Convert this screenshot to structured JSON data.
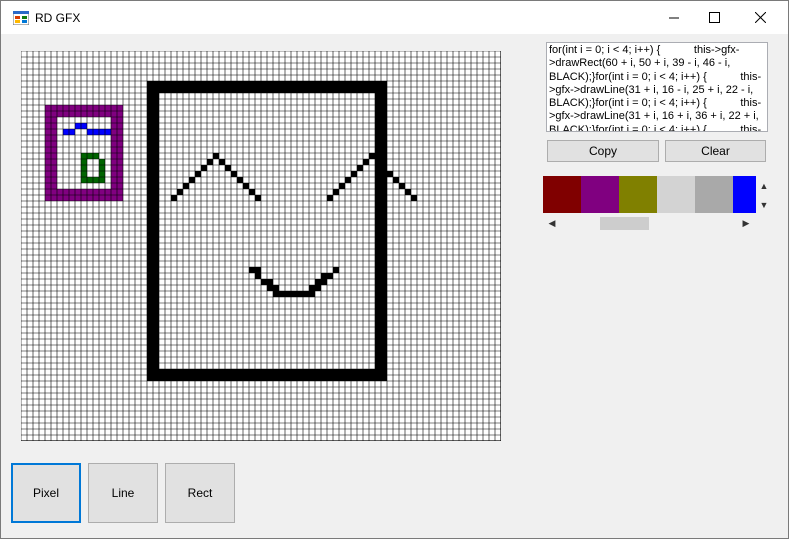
{
  "window": {
    "title": "RD GFX",
    "minimize_icon": "minimize-icon",
    "maximize_icon": "maximize-icon",
    "close_icon": "close-icon"
  },
  "code": {
    "text": "for(int i = 0; i < 4; i++) {           this->gfx->drawRect(60 + i, 50 + i, 39 - i, 46 - i, BLACK);}for(int i = 0; i < 4; i++) {           this->gfx->drawLine(31 + i, 16 - i, 25 + i, 22 - i, BLACK);}for(int i = 0; i < 4; i++) {           this->gfx->drawLine(31 + i, 16 + i, 36 + i, 22 + i, BLACK);}for(int i = 0; i < 4; i++) {           this-"
  },
  "buttons": {
    "copy": "Copy",
    "clear": "Clear"
  },
  "palette": {
    "colors": [
      "#800000",
      "#800080",
      "#808000",
      "#d3d3d3",
      "#a9a9a9",
      "#0000ff"
    ],
    "scroll_up_icon": "scroll-up-icon",
    "scroll_down_icon": "scroll-down-icon"
  },
  "tools": {
    "pixel": "Pixel",
    "line": "Line",
    "rect": "Rect",
    "selected": "Pixel"
  },
  "canvas": {
    "cols": 80,
    "rows": 65,
    "grid_color": "#000000",
    "cell_off_color": "#ffffff",
    "layers": [
      {
        "color": "#000000",
        "rects": [
          [
            21,
            5,
            60,
            54
          ]
        ],
        "thickness": 1
      },
      {
        "color": "#000000",
        "rects": [
          [
            22,
            6,
            59,
            53
          ]
        ],
        "thickness": 1
      },
      {
        "color": "#800080",
        "rects": [
          [
            4,
            9,
            16,
            24
          ]
        ],
        "thickness": 1
      },
      {
        "color": "#800080",
        "rects": [
          [
            5,
            10,
            15,
            23
          ]
        ],
        "thickness": 1
      }
    ],
    "pixels": [
      {
        "color": "#0000ff",
        "cells": [
          [
            7,
            13
          ],
          [
            8,
            13
          ],
          [
            9,
            12
          ],
          [
            10,
            12
          ],
          [
            11,
            13
          ],
          [
            12,
            13
          ],
          [
            13,
            13
          ],
          [
            14,
            13
          ]
        ]
      },
      {
        "color": "#006400",
        "cells": [
          [
            10,
            17
          ],
          [
            11,
            17
          ],
          [
            12,
            17
          ],
          [
            10,
            18
          ],
          [
            13,
            18
          ],
          [
            10,
            19
          ],
          [
            13,
            19
          ],
          [
            10,
            20
          ],
          [
            13,
            20
          ],
          [
            10,
            21
          ],
          [
            11,
            21
          ],
          [
            12,
            21
          ],
          [
            13,
            21
          ]
        ]
      },
      {
        "color": "#000000",
        "cells": [
          [
            25,
            24
          ],
          [
            26,
            23
          ],
          [
            27,
            22
          ],
          [
            28,
            21
          ],
          [
            29,
            20
          ],
          [
            30,
            19
          ],
          [
            31,
            18
          ],
          [
            32,
            17
          ],
          [
            33,
            18
          ],
          [
            34,
            19
          ],
          [
            35,
            20
          ],
          [
            36,
            21
          ],
          [
            37,
            22
          ],
          [
            38,
            23
          ],
          [
            39,
            24
          ],
          [
            51,
            24
          ],
          [
            52,
            23
          ],
          [
            53,
            22
          ],
          [
            54,
            21
          ],
          [
            55,
            20
          ],
          [
            56,
            19
          ],
          [
            57,
            18
          ],
          [
            58,
            17
          ],
          [
            59,
            18
          ],
          [
            60,
            19
          ],
          [
            61,
            20
          ],
          [
            62,
            21
          ],
          [
            63,
            22
          ],
          [
            64,
            23
          ],
          [
            65,
            24
          ],
          [
            38,
            36
          ],
          [
            39,
            37
          ],
          [
            40,
            38
          ],
          [
            41,
            39
          ],
          [
            42,
            40
          ],
          [
            43,
            40
          ],
          [
            44,
            40
          ],
          [
            45,
            40
          ],
          [
            46,
            40
          ],
          [
            47,
            40
          ],
          [
            48,
            40
          ],
          [
            49,
            39
          ],
          [
            50,
            38
          ],
          [
            51,
            37
          ],
          [
            52,
            36
          ],
          [
            39,
            36
          ],
          [
            41,
            38
          ],
          [
            42,
            39
          ],
          [
            48,
            39
          ],
          [
            49,
            38
          ],
          [
            50,
            37
          ]
        ]
      }
    ]
  }
}
